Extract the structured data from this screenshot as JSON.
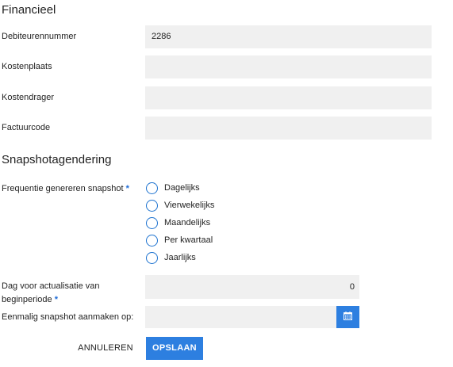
{
  "financial": {
    "title": "Financieel",
    "fields": [
      {
        "label": "Debiteurennummer",
        "value": "2286"
      },
      {
        "label": "Kostenplaats",
        "value": ""
      },
      {
        "label": "Kostendrager",
        "value": ""
      },
      {
        "label": "Factuurcode",
        "value": ""
      }
    ]
  },
  "snapshot": {
    "title": "Snapshotagendering",
    "frequency_label": "Frequentie genereren snapshot",
    "required_mark": "*",
    "options": [
      "Dagelijks",
      "Vierwekelijks",
      "Maandelijks",
      "Per kwartaal",
      "Jaarlijks"
    ],
    "day_label_line1": "Dag voor actualisatie van",
    "day_label_line2": "beginperiode",
    "day_value": "0",
    "once_label": "Eenmalig snapshot aanmaken op:",
    "once_value": ""
  },
  "actions": {
    "cancel": "ANNULEREN",
    "save": "OPSLAAN"
  },
  "colors": {
    "accent": "#2d7fe0",
    "input_bg": "#f0f0f0"
  },
  "icons": {
    "calendar": "calendar-icon"
  }
}
